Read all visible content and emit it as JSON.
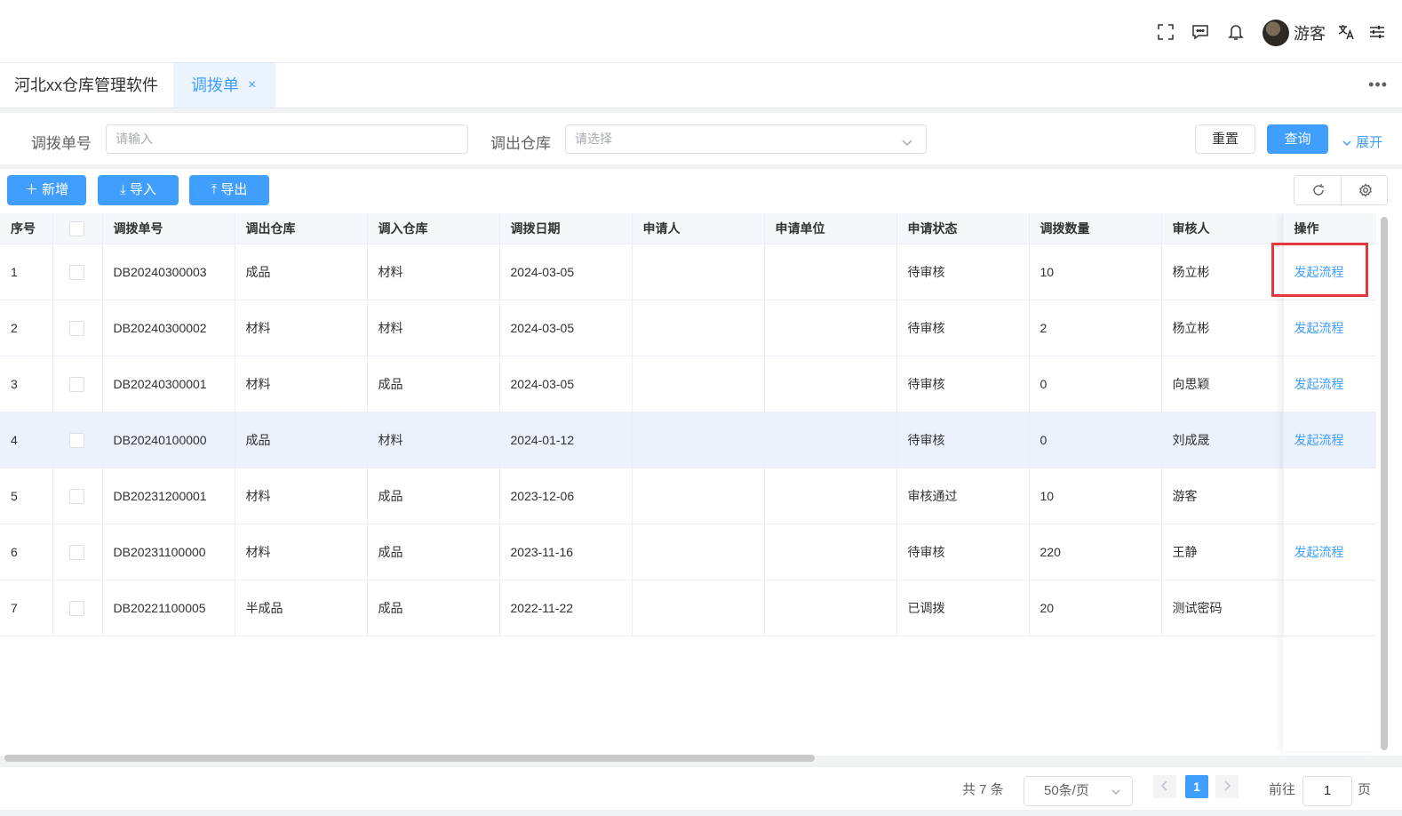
{
  "header": {
    "username": "游客",
    "icons": [
      "fullscreen-icon",
      "message-icon",
      "bell-icon",
      "translate-icon",
      "settings-sliders-icon"
    ]
  },
  "tabs": {
    "items": [
      {
        "label": "河北xx仓库管理软件"
      },
      {
        "label": "调拨单",
        "active": true,
        "close": "×"
      }
    ],
    "more": "•••"
  },
  "filter": {
    "order_no_label": "调拨单号",
    "order_no_placeholder": "请输入",
    "out_wh_label": "调出仓库",
    "out_wh_placeholder": "请选择",
    "reset_label": "重置",
    "query_label": "查询",
    "expand_label": "展开"
  },
  "toolbar": {
    "add_label": "新增",
    "import_label": "导入",
    "export_label": "导出"
  },
  "table": {
    "columns": [
      "序号",
      "",
      "调拨单号",
      "调出仓库",
      "调入仓库",
      "调拨日期",
      "申请人",
      "申请单位",
      "申请状态",
      "调拨数量",
      "审核人",
      "操作"
    ],
    "action_label": "发起流程",
    "rows": [
      {
        "idx": "1",
        "no": "DB20240300003",
        "out": "成品",
        "in": "材料",
        "date": "2024-03-05",
        "applicant": "",
        "unit": "",
        "status": "待审核",
        "qty": "10",
        "auditor": "杨立彬",
        "action": "发起流程"
      },
      {
        "idx": "2",
        "no": "DB20240300002",
        "out": "材料",
        "in": "材料",
        "date": "2024-03-05",
        "applicant": "",
        "unit": "",
        "status": "待审核",
        "qty": "2",
        "auditor": "杨立彬",
        "action": "发起流程"
      },
      {
        "idx": "3",
        "no": "DB20240300001",
        "out": "材料",
        "in": "成品",
        "date": "2024-03-05",
        "applicant": "",
        "unit": "",
        "status": "待审核",
        "qty": "0",
        "auditor": "向思颖",
        "action": "发起流程"
      },
      {
        "idx": "4",
        "no": "DB20240100000",
        "out": "成品",
        "in": "材料",
        "date": "2024-01-12",
        "applicant": "",
        "unit": "",
        "status": "待审核",
        "qty": "0",
        "auditor": "刘成晟",
        "action": "发起流程"
      },
      {
        "idx": "5",
        "no": "DB20231200001",
        "out": "材料",
        "in": "成品",
        "date": "2023-12-06",
        "applicant": "",
        "unit": "",
        "status": "审核通过",
        "qty": "10",
        "auditor": "游客",
        "action": ""
      },
      {
        "idx": "6",
        "no": "DB20231100000",
        "out": "材料",
        "in": "成品",
        "date": "2023-11-16",
        "applicant": "",
        "unit": "",
        "status": "待审核",
        "qty": "220",
        "auditor": "王静",
        "action": "发起流程"
      },
      {
        "idx": "7",
        "no": "DB20221100005",
        "out": "半成品",
        "in": "成品",
        "date": "2022-11-22",
        "applicant": "",
        "unit": "",
        "status": "已调拨",
        "qty": "20",
        "auditor": "测试密码",
        "action": ""
      }
    ]
  },
  "pagination": {
    "total": "共 7 条",
    "page_size": "50条/页",
    "current": "1",
    "goto_label": "前往",
    "goto_value": "1",
    "page_suffix": "页"
  },
  "colors": {
    "primary": "#409eff",
    "highlight_box": "#e4393c",
    "hover_row": "#ecf2fb"
  }
}
